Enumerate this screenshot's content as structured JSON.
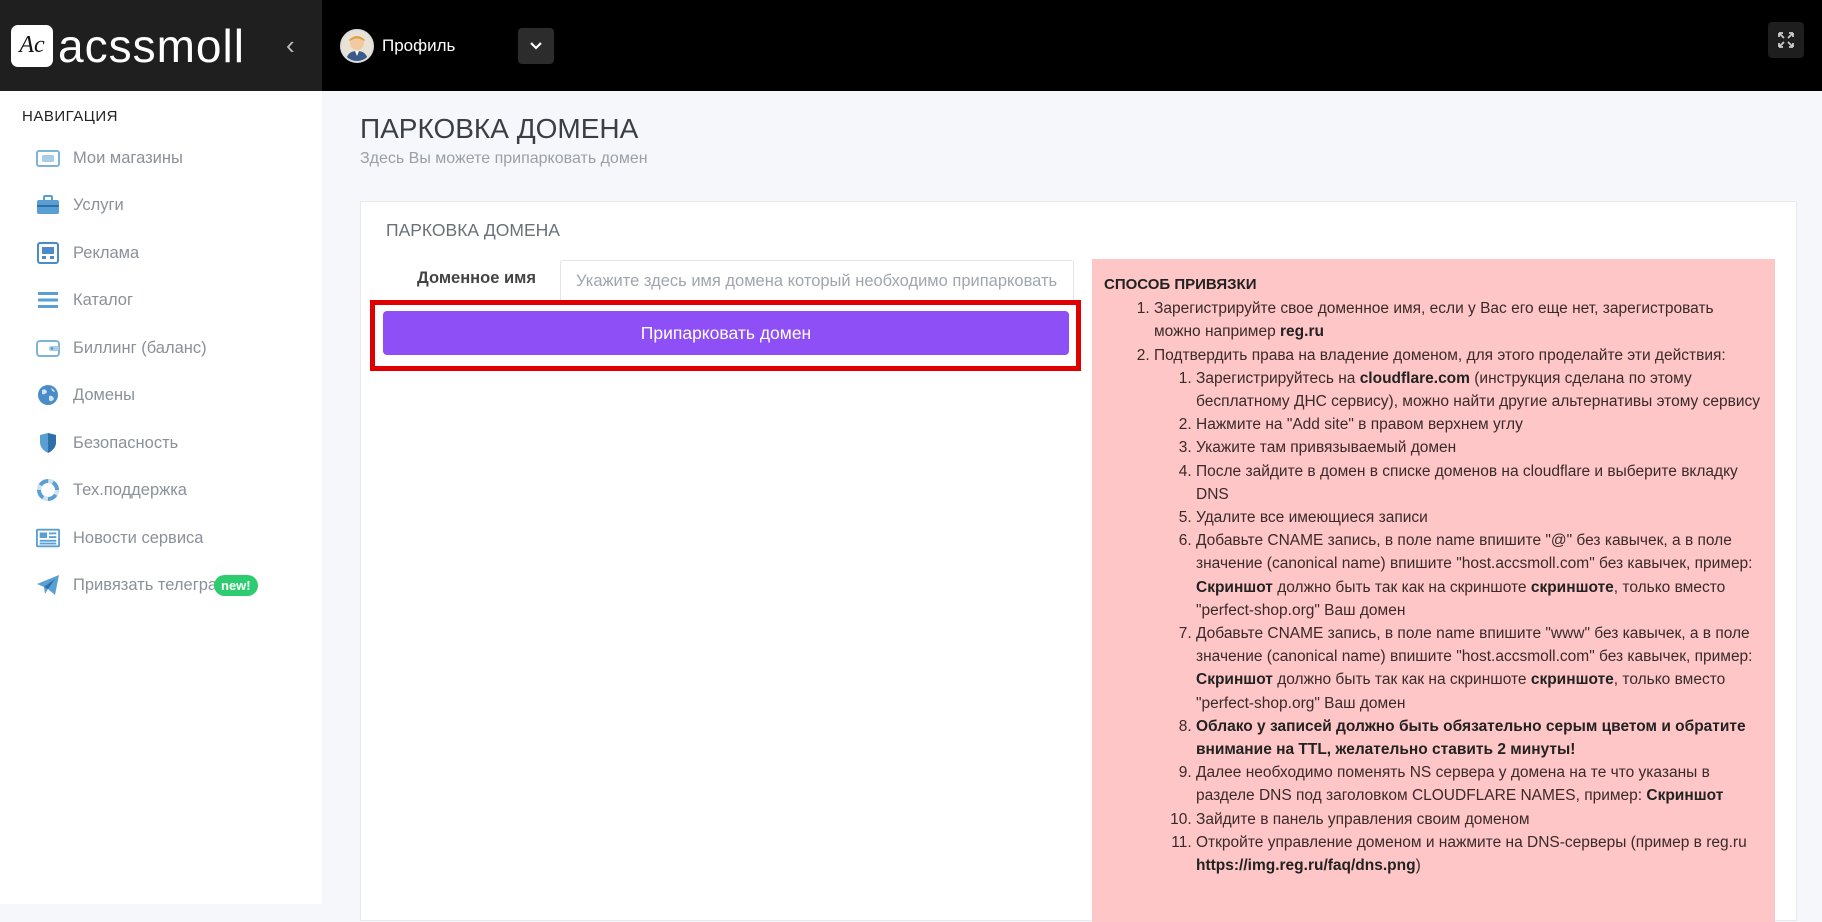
{
  "brand": {
    "logo_text": "Ac",
    "name": "acssmoll"
  },
  "header": {
    "profile_name": "Профиль"
  },
  "sidebar": {
    "heading": "НАВИГАЦИЯ",
    "items": [
      {
        "label": "Мои магазины",
        "icon": "wallet-icon"
      },
      {
        "label": "Услуги",
        "icon": "briefcase-icon"
      },
      {
        "label": "Реклама",
        "icon": "billboard-icon"
      },
      {
        "label": "Каталог",
        "icon": "list-icon"
      },
      {
        "label": "Биллинг (баланс)",
        "icon": "card-wallet-icon"
      },
      {
        "label": "Домены",
        "icon": "globe-icon"
      },
      {
        "label": "Безопасность",
        "icon": "shield-icon"
      },
      {
        "label": "Тех.поддержка",
        "icon": "lifebuoy-icon"
      },
      {
        "label": "Новости сервиса",
        "icon": "newspaper-icon"
      },
      {
        "label": "Привязать телеграм",
        "icon": "telegram-icon",
        "badge": "new!"
      }
    ]
  },
  "page": {
    "title": "ПАРКОВКА ДОМЕНА",
    "subtitle": "Здесь Вы можете припарковать домен"
  },
  "card": {
    "title": "ПАРКОВКА ДОМЕНА",
    "domain_label": "Доменное имя",
    "domain_placeholder": "Укажите здесь имя домена который необходимо припарковать",
    "domain_value": "",
    "submit_label": "Припарковать домен"
  },
  "instructions": {
    "title": "СПОСОБ ПРИВЯЗКИ",
    "step1_text": "Зарегистрируйте свое доменное имя, если у Вас его еще нет, зарегистровать можно например ",
    "step1_bold": "reg.ru",
    "step2_text": "Подтвердить права на владение доменом, для этого проделайте эти действия:",
    "sub1_pre": "Зарегистрируйтесь на ",
    "sub1_bold": "cloudflare.com",
    "sub1_post": " (инструкция сделана по этому бесплатному ДНС сервису), можно найти другие альтернативы этому сервису",
    "sub2": "Нажмите на \"Add site\" в правом верхнем углу",
    "sub3": "Укажите там привязываемый домен",
    "sub4": "После зайдите в домен в списке доменов на cloudflare и выберите вкладку DNS",
    "sub5": "Удалите все имеющиеся записи",
    "sub6_pre": "Добавьте CNAME запись, в поле name впишите \"@\" без кавычек, а в поле значение (canonical name) впишите \"host.accsmoll.com\" без кавычек, пример: ",
    "sub6_bold1": "Скриншот",
    "sub6_mid": " должно быть так как на скриншоте ",
    "sub6_bold2": "скриншоте",
    "sub6_post": ", только вместо \"perfect-shop.org\" Ваш домен",
    "sub7_pre": "Добавьте CNAME запись, в поле name впишите \"www\" без кавычек, а в поле значение (canonical name) впишите \"host.accsmoll.com\" без кавычек, пример: ",
    "sub7_bold1": "Скриншот",
    "sub7_mid": " должно быть так как на скриншоте ",
    "sub7_bold2": "скриншоте",
    "sub7_post": ", только вместо \"perfect-shop.org\" Ваш домен",
    "sub8_bold": "Облако у записей должно быть обязательно серым цветом и обратите внимание на TTL, желательно ставить 2 минуты!",
    "sub9_pre": "Далее необходимо поменять NS сервера у домена на те что указаны в разделе DNS под заголовком CLOUDFLARE NAMES, пример: ",
    "sub9_bold": "Скриншот",
    "sub10": "Зайдите в панель управления своим доменом",
    "sub11_pre": "Откройте управление доменом и нажмите на DNS-серверы (пример в reg.ru ",
    "sub11_bold": "https://img.reg.ru/faq/dns.png",
    "sub11_post": ")"
  },
  "colors": {
    "accent": "#8e4ff7",
    "highlight": "#e00000",
    "instructions_bg": "#fec6c6",
    "badge": "#2ecc71"
  }
}
